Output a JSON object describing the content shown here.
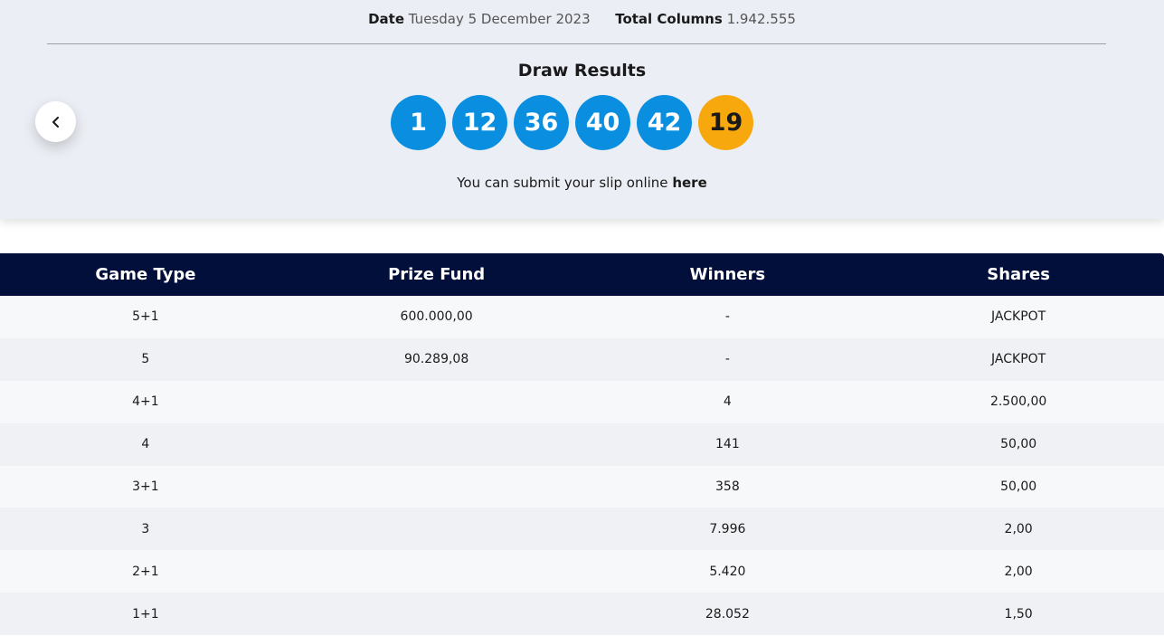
{
  "meta": {
    "date_label": "Date",
    "date_value": "Tuesday 5 December 2023",
    "columns_label": "Total Columns",
    "columns_value": "1.942.555"
  },
  "draw": {
    "title": "Draw Results",
    "numbers": [
      "1",
      "12",
      "36",
      "40",
      "42"
    ],
    "bonus": "19",
    "colors": {
      "main": "#0a8fe0",
      "bonus": "#f7a80c"
    },
    "submit_text": "You can submit your slip online",
    "submit_link": "here"
  },
  "nav": {
    "prev_icon": "chevron-left-icon"
  },
  "table": {
    "headers": [
      "Game Type",
      "Prize Fund",
      "Winners",
      "Shares"
    ],
    "rows": [
      [
        "5+1",
        "600.000,00",
        "-",
        "JACKPOT"
      ],
      [
        "5",
        "90.289,08",
        "-",
        "JACKPOT"
      ],
      [
        "4+1",
        "",
        "4",
        "2.500,00"
      ],
      [
        "4",
        "",
        "141",
        "50,00"
      ],
      [
        "3+1",
        "",
        "358",
        "50,00"
      ],
      [
        "3",
        "",
        "7.996",
        "2,00"
      ],
      [
        "2+1",
        "",
        "5.420",
        "2,00"
      ],
      [
        "1+1",
        "",
        "28.052",
        "1,50"
      ]
    ],
    "header_bg": "#020f3b"
  }
}
